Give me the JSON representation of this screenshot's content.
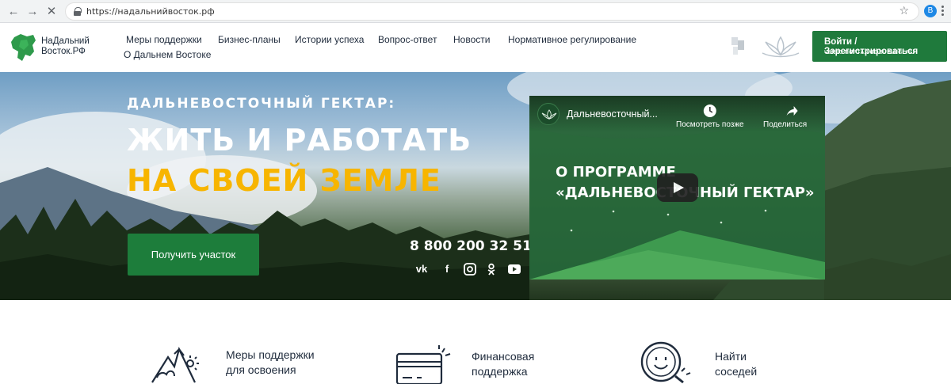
{
  "browser": {
    "url": "https://надальнийвосток.рф",
    "profile_initial": "В"
  },
  "site": {
    "logo_line1": "НаДальний",
    "logo_line2": "Восток.РФ",
    "nav": [
      {
        "label": "Меры поддержки"
      },
      {
        "label": "Бизнес-планы"
      },
      {
        "label": "Истории успеха"
      },
      {
        "label": "Вопрос-ответ"
      },
      {
        "label": "Новости"
      },
      {
        "label": "Нормативное регулирование"
      },
      {
        "label": "О Дальнем Востоке"
      }
    ],
    "login": {
      "label": "Войти / Зарегистрироваться",
      "sublabel": "ЧЕРЕЗ ПОРТАЛ GOSUSLUGI.RU"
    }
  },
  "hero": {
    "eyebrow": "ДАЛЬНЕВОСТОЧНЫЙ ГЕКТАР:",
    "title_line1": "ЖИТЬ И РАБОТАТЬ",
    "title_line2": "НА СВОЕЙ ЗЕМЛЕ",
    "cta_label": "Получить участок",
    "phone": "8 800 200 32 51",
    "socials": [
      "vk-icon",
      "facebook-icon",
      "instagram-icon",
      "odnoklassniki-icon",
      "youtube-icon"
    ]
  },
  "video": {
    "title": "Дальневосточный...",
    "watch_later": "Посмотреть позже",
    "share": "Поделиться",
    "overlay_line1": "О ПРОГРАММЕ",
    "overlay_line2": "«ДАЛЬНЕВОСТОЧНЫЙ ГЕКТАР»"
  },
  "features": [
    {
      "line1": "Меры поддержки",
      "line2": "для освоения",
      "icon": "mountains-icon"
    },
    {
      "line1": "Финансовая",
      "line2": "поддержка",
      "icon": "card-icon"
    },
    {
      "line1": "Найти",
      "line2": "соседей",
      "icon": "magnifier-face-icon"
    }
  ],
  "colors": {
    "brand_green": "#1f7a3c",
    "accent_yellow": "#f7b500",
    "text_dark": "#1f2b3c"
  }
}
